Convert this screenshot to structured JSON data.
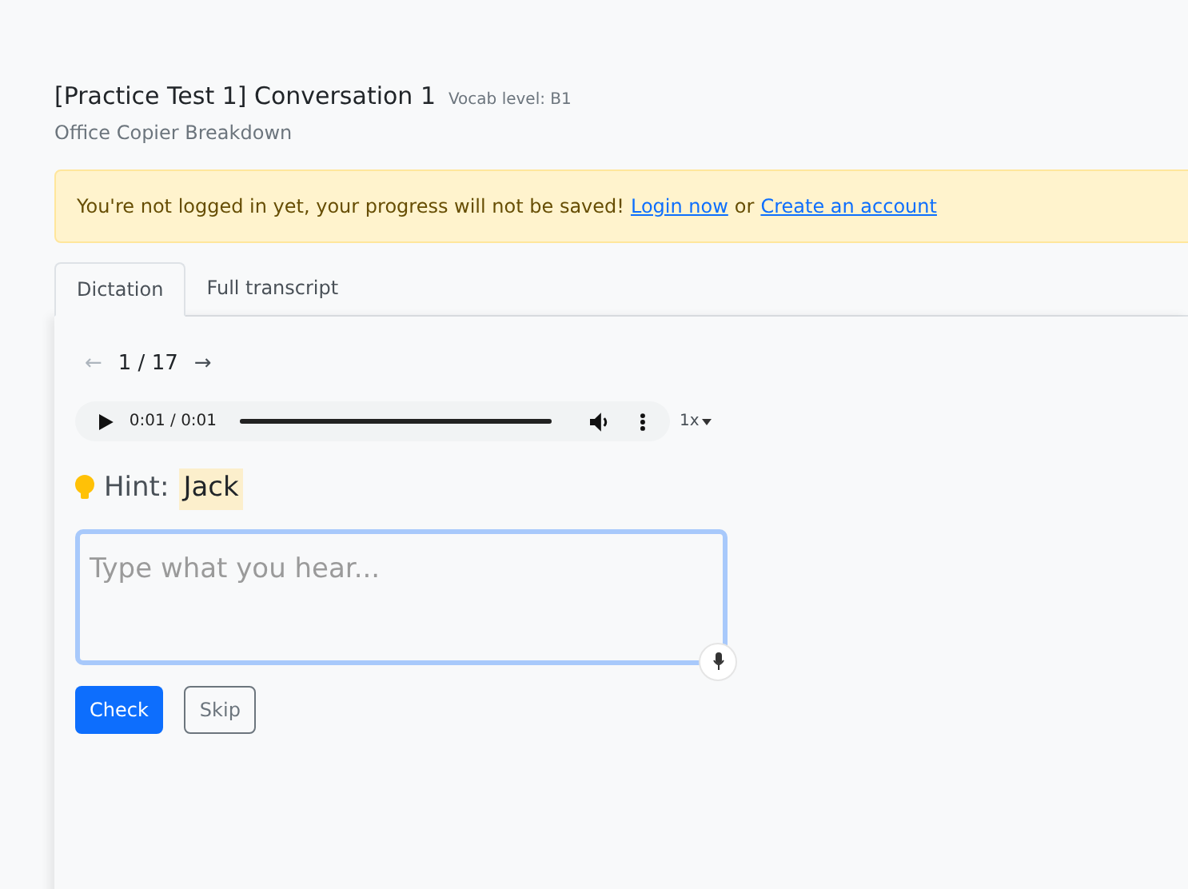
{
  "lesson": {
    "title": "[Practice Test 1] Conversation 1",
    "vocab_level": "Vocab level: B1",
    "subtitle": "Office Copier Breakdown"
  },
  "alert": {
    "message": "You're not logged in yet, your progress will not be saved!",
    "login_link": "Login now",
    "joiner": "or",
    "signup_link": "Create an account"
  },
  "tabs": [
    {
      "label": "Dictation",
      "selected": true
    },
    {
      "label": "Full transcript",
      "selected": false
    }
  ],
  "pager": {
    "prev": {
      "label": "←",
      "disabled": true
    },
    "position": "1 / 17",
    "next": {
      "label": "→",
      "disabled": false
    }
  },
  "audio": {
    "time": "0:01 / 0:01",
    "level": 1,
    "speed": "1x"
  },
  "hint": {
    "label": "Hint:",
    "word": "Jack"
  },
  "answer": {
    "placeholder": "Type what you hear..."
  },
  "buttons": [
    {
      "label": "Check",
      "kind": "primary"
    },
    {
      "label": "Skip",
      "kind": "secondary"
    }
  ]
}
